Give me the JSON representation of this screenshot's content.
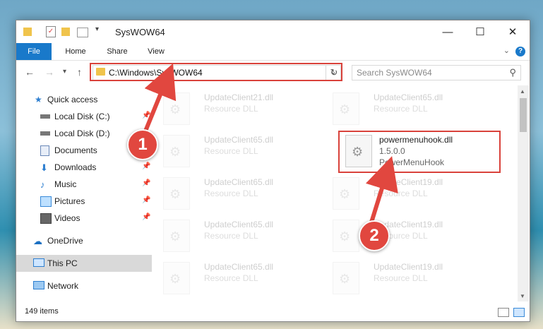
{
  "window": {
    "title": "SysWOW64"
  },
  "ribbon": {
    "tabs": [
      {
        "label": "File"
      },
      {
        "label": "Home"
      },
      {
        "label": "Share"
      },
      {
        "label": "View"
      }
    ]
  },
  "controls": {
    "minimize": "—",
    "maximize": "☐",
    "close": "✕"
  },
  "address": {
    "path": "C:\\Windows\\SysWOW64",
    "search_placeholder": "Search SysWOW64"
  },
  "sidebar": {
    "items": [
      {
        "label": "Quick access",
        "icon": "star-icon",
        "pinned": false
      },
      {
        "label": "Local Disk (C:)",
        "icon": "drive-icon",
        "pinned": true
      },
      {
        "label": "Local Disk (D:)",
        "icon": "drive-icon",
        "pinned": false
      },
      {
        "label": "Documents",
        "icon": "documents-icon",
        "pinned": true
      },
      {
        "label": "Downloads",
        "icon": "downloads-icon",
        "pinned": true
      },
      {
        "label": "Music",
        "icon": "music-icon",
        "pinned": true
      },
      {
        "label": "Pictures",
        "icon": "pictures-icon",
        "pinned": true
      },
      {
        "label": "Videos",
        "icon": "videos-icon",
        "pinned": true
      },
      {
        "label": "OneDrive",
        "icon": "cloud-icon",
        "pinned": false
      },
      {
        "label": "This PC",
        "icon": "pc-icon",
        "pinned": false,
        "selected": true
      },
      {
        "label": "Network",
        "icon": "network-icon",
        "pinned": false
      }
    ]
  },
  "files": {
    "highlighted": {
      "name": "powermenuhook.dll",
      "version": "1.5.0.0",
      "desc": "PowerMenuHook"
    },
    "background": [
      {
        "name": "UpdateClient21.dll",
        "type": "Resource DLL"
      },
      {
        "name": "UpdateClient65.dll",
        "type": "Resource DLL"
      },
      {
        "name": "UpdateClient65.dll",
        "type": "Resource DLL"
      },
      {
        "name": "UpdateClient65.dll",
        "type": "Resource DLL"
      },
      {
        "name": "UpdateClient19.dll",
        "type": "Resource DLL"
      },
      {
        "name": "UpdateClient65.dll",
        "type": "Resource DLL"
      },
      {
        "name": "UpdateClient19.dll",
        "type": "Resource DLL"
      },
      {
        "name": "UpdateClient65.dll",
        "type": "Resource DLL"
      },
      {
        "name": "UpdateClient19.dll",
        "type": "Resource DLL"
      }
    ]
  },
  "status": {
    "count": "149 items"
  },
  "annotations": {
    "step1": "1",
    "step2": "2",
    "color": "#e1473f"
  }
}
